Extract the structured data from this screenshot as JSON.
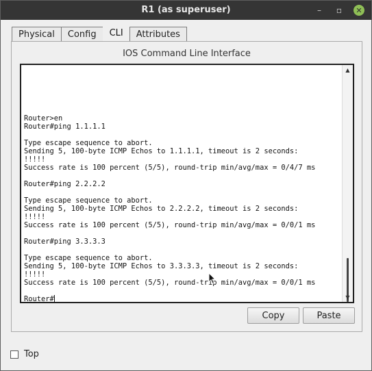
{
  "window": {
    "title": "R1 (as superuser)",
    "controls": {
      "minimize": "–",
      "maximize": "▫",
      "close": "✕"
    }
  },
  "tabs": [
    {
      "label": "Physical",
      "active": false
    },
    {
      "label": "Config",
      "active": false
    },
    {
      "label": "CLI",
      "active": true
    },
    {
      "label": "Attributes",
      "active": false
    }
  ],
  "panel": {
    "title": "IOS Command Line Interface"
  },
  "cli": {
    "output": "Router>en\nRouter#ping 1.1.1.1\n\nType escape sequence to abort.\nSending 5, 100-byte ICMP Echos to 1.1.1.1, timeout is 2 seconds:\n!!!!!\nSuccess rate is 100 percent (5/5), round-trip min/avg/max = 0/4/7 ms\n\nRouter#ping 2.2.2.2\n\nType escape sequence to abort.\nSending 5, 100-byte ICMP Echos to 2.2.2.2, timeout is 2 seconds:\n!!!!!\nSuccess rate is 100 percent (5/5), round-trip min/avg/max = 0/0/1 ms\n\nRouter#ping 3.3.3.3\n\nType escape sequence to abort.\nSending 5, 100-byte ICMP Echos to 3.3.3.3, timeout is 2 seconds:\n!!!!!\nSuccess rate is 100 percent (5/5), round-trip min/avg/max = 0/0/1 ms\n\n",
    "prompt": "Router#",
    "scroll_up_icon": "▲",
    "scroll_down_icon": "▼"
  },
  "buttons": {
    "copy": "Copy",
    "paste": "Paste"
  },
  "footer": {
    "top_label": "Top",
    "top_checked": false
  },
  "colors": {
    "titlebar": "#353535",
    "close_button": "#8fbf56",
    "window_bg": "#efefef"
  }
}
